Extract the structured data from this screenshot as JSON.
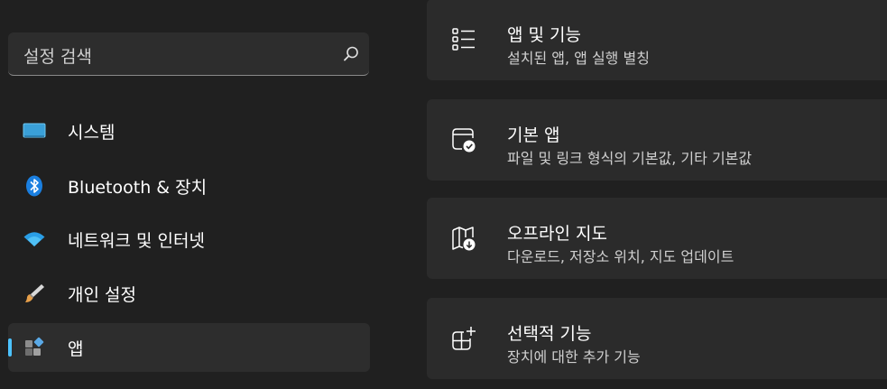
{
  "search": {
    "placeholder": "설정 검색",
    "icon": "search-icon"
  },
  "sidebar": {
    "accent_color": "#4cc2ff",
    "items": [
      {
        "label": "시스템",
        "icon": "monitor-icon"
      },
      {
        "label": "Bluetooth & 장치",
        "icon": "bluetooth-icon"
      },
      {
        "label": "네트워크 및 인터넷",
        "icon": "wifi-icon"
      },
      {
        "label": "개인 설정",
        "icon": "brush-icon"
      },
      {
        "label": "앱",
        "icon": "apps-icon",
        "selected": true
      }
    ]
  },
  "cards": [
    {
      "title": "앱 및 기능",
      "subtitle": "설치된 앱, 앱 실행 별칭",
      "icon": "list-icon"
    },
    {
      "title": "기본 앱",
      "subtitle": "파일 및 링크 형식의 기본값, 기타 기본값",
      "icon": "default-app-check-icon"
    },
    {
      "title": "오프라인 지도",
      "subtitle": "다운로드, 저장소 위치, 지도 업데이트",
      "icon": "map-download-icon"
    },
    {
      "title": "선택적 기능",
      "subtitle": "장치에 대한 추가 기능",
      "icon": "add-feature-icon"
    }
  ]
}
